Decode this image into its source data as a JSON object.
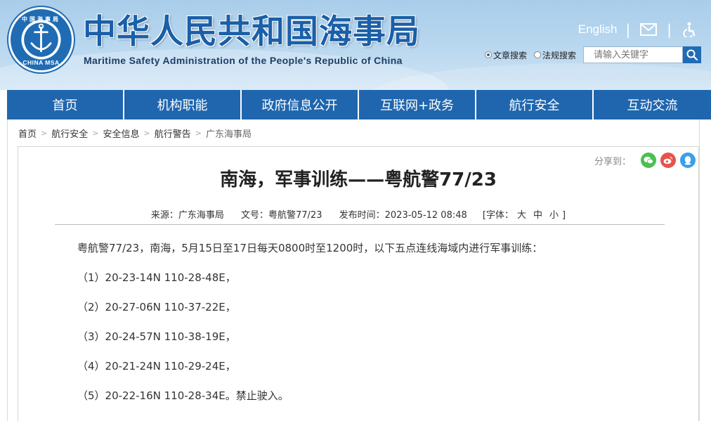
{
  "header": {
    "logo_top": "中国海事局",
    "logo_bottom": "CHINA MSA",
    "title": "中华人民共和国海事局",
    "subtitle": "Maritime Safety Administration of the People's Republic of China",
    "english_label": "English",
    "search": {
      "option_article": "文章搜索",
      "option_law": "法规搜索",
      "placeholder": "请输入关键字"
    }
  },
  "nav": {
    "items": [
      "首页",
      "机构职能",
      "政府信息公开",
      "互联网+政务",
      "航行安全",
      "互动交流"
    ]
  },
  "breadcrumb": [
    "首页",
    "航行安全",
    "安全信息",
    "航行警告",
    "广东海事局"
  ],
  "share": {
    "label": "分享到："
  },
  "article": {
    "title": "南海，军事训练——粤航警77/23",
    "meta": {
      "source": "来源：广东海事局",
      "doc_no": "文号：粤航警77/23",
      "published": "发布时间：2023-05-12 08:48",
      "font_open": "[字体：",
      "font_large": "大",
      "font_medium": "中",
      "font_small": "小",
      "font_close": "]"
    },
    "paragraphs": [
      "粤航警77/23，南海，5月15日至17日每天0800时至1200时，以下五点连线海域内进行军事训练：",
      "（1）20-23-14N 110-28-48E，",
      "（2）20-27-06N 110-37-22E，",
      "（3）20-24-57N 110-38-19E，",
      "（4）20-21-24N 110-29-24E，",
      "（5）20-22-16N 110-28-34E。禁止驶入。"
    ]
  },
  "colors": {
    "brand_blue": "#1f66ae",
    "wechat": "#4cbf52",
    "weibo": "#e6534b",
    "qq": "#3aa0e8"
  }
}
